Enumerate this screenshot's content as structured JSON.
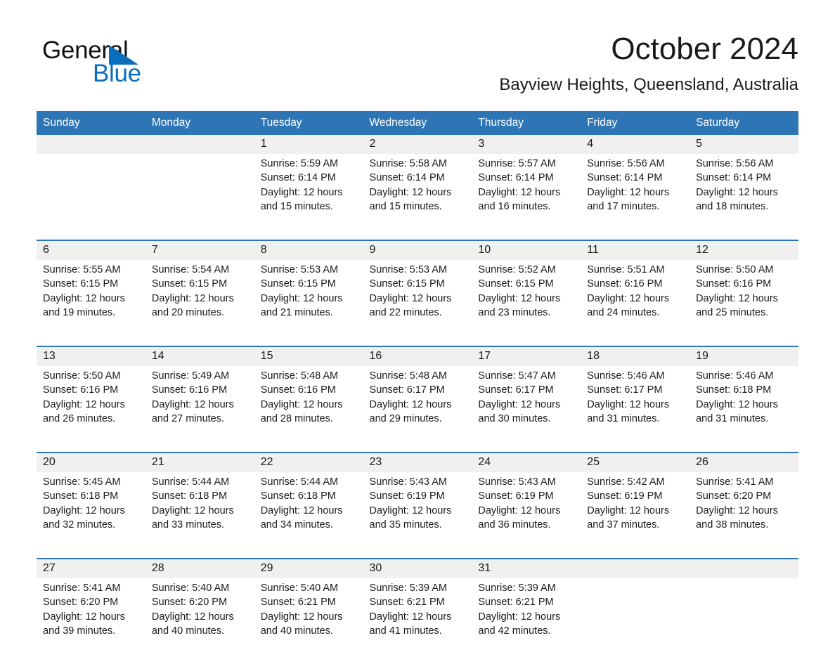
{
  "brand": {
    "name_part1": "General",
    "name_part2": "Blue",
    "triangle_color": "#0a6ebd",
    "blue_color": "#0a6ebd"
  },
  "header": {
    "month_title": "October 2024",
    "location": "Bayview Heights, Queensland, Australia"
  },
  "theme": {
    "header_blue": "#2e75b6",
    "daynum_bg": "#f0f0f0",
    "cell_bg": "#ffffff",
    "text_color": "#1a1a1a"
  },
  "weekday_headers": [
    "Sunday",
    "Monday",
    "Tuesday",
    "Wednesday",
    "Thursday",
    "Friday",
    "Saturday"
  ],
  "weeks": [
    [
      {
        "day": "",
        "sunrise": "",
        "sunset": "",
        "daylight": "",
        "daylight2": ""
      },
      {
        "day": "",
        "sunrise": "",
        "sunset": "",
        "daylight": "",
        "daylight2": ""
      },
      {
        "day": "1",
        "sunrise": "Sunrise: 5:59 AM",
        "sunset": "Sunset: 6:14 PM",
        "daylight": "Daylight: 12 hours",
        "daylight2": "and 15 minutes."
      },
      {
        "day": "2",
        "sunrise": "Sunrise: 5:58 AM",
        "sunset": "Sunset: 6:14 PM",
        "daylight": "Daylight: 12 hours",
        "daylight2": "and 15 minutes."
      },
      {
        "day": "3",
        "sunrise": "Sunrise: 5:57 AM",
        "sunset": "Sunset: 6:14 PM",
        "daylight": "Daylight: 12 hours",
        "daylight2": "and 16 minutes."
      },
      {
        "day": "4",
        "sunrise": "Sunrise: 5:56 AM",
        "sunset": "Sunset: 6:14 PM",
        "daylight": "Daylight: 12 hours",
        "daylight2": "and 17 minutes."
      },
      {
        "day": "5",
        "sunrise": "Sunrise: 5:56 AM",
        "sunset": "Sunset: 6:14 PM",
        "daylight": "Daylight: 12 hours",
        "daylight2": "and 18 minutes."
      }
    ],
    [
      {
        "day": "6",
        "sunrise": "Sunrise: 5:55 AM",
        "sunset": "Sunset: 6:15 PM",
        "daylight": "Daylight: 12 hours",
        "daylight2": "and 19 minutes."
      },
      {
        "day": "7",
        "sunrise": "Sunrise: 5:54 AM",
        "sunset": "Sunset: 6:15 PM",
        "daylight": "Daylight: 12 hours",
        "daylight2": "and 20 minutes."
      },
      {
        "day": "8",
        "sunrise": "Sunrise: 5:53 AM",
        "sunset": "Sunset: 6:15 PM",
        "daylight": "Daylight: 12 hours",
        "daylight2": "and 21 minutes."
      },
      {
        "day": "9",
        "sunrise": "Sunrise: 5:53 AM",
        "sunset": "Sunset: 6:15 PM",
        "daylight": "Daylight: 12 hours",
        "daylight2": "and 22 minutes."
      },
      {
        "day": "10",
        "sunrise": "Sunrise: 5:52 AM",
        "sunset": "Sunset: 6:15 PM",
        "daylight": "Daylight: 12 hours",
        "daylight2": "and 23 minutes."
      },
      {
        "day": "11",
        "sunrise": "Sunrise: 5:51 AM",
        "sunset": "Sunset: 6:16 PM",
        "daylight": "Daylight: 12 hours",
        "daylight2": "and 24 minutes."
      },
      {
        "day": "12",
        "sunrise": "Sunrise: 5:50 AM",
        "sunset": "Sunset: 6:16 PM",
        "daylight": "Daylight: 12 hours",
        "daylight2": "and 25 minutes."
      }
    ],
    [
      {
        "day": "13",
        "sunrise": "Sunrise: 5:50 AM",
        "sunset": "Sunset: 6:16 PM",
        "daylight": "Daylight: 12 hours",
        "daylight2": "and 26 minutes."
      },
      {
        "day": "14",
        "sunrise": "Sunrise: 5:49 AM",
        "sunset": "Sunset: 6:16 PM",
        "daylight": "Daylight: 12 hours",
        "daylight2": "and 27 minutes."
      },
      {
        "day": "15",
        "sunrise": "Sunrise: 5:48 AM",
        "sunset": "Sunset: 6:16 PM",
        "daylight": "Daylight: 12 hours",
        "daylight2": "and 28 minutes."
      },
      {
        "day": "16",
        "sunrise": "Sunrise: 5:48 AM",
        "sunset": "Sunset: 6:17 PM",
        "daylight": "Daylight: 12 hours",
        "daylight2": "and 29 minutes."
      },
      {
        "day": "17",
        "sunrise": "Sunrise: 5:47 AM",
        "sunset": "Sunset: 6:17 PM",
        "daylight": "Daylight: 12 hours",
        "daylight2": "and 30 minutes."
      },
      {
        "day": "18",
        "sunrise": "Sunrise: 5:46 AM",
        "sunset": "Sunset: 6:17 PM",
        "daylight": "Daylight: 12 hours",
        "daylight2": "and 31 minutes."
      },
      {
        "day": "19",
        "sunrise": "Sunrise: 5:46 AM",
        "sunset": "Sunset: 6:18 PM",
        "daylight": "Daylight: 12 hours",
        "daylight2": "and 31 minutes."
      }
    ],
    [
      {
        "day": "20",
        "sunrise": "Sunrise: 5:45 AM",
        "sunset": "Sunset: 6:18 PM",
        "daylight": "Daylight: 12 hours",
        "daylight2": "and 32 minutes."
      },
      {
        "day": "21",
        "sunrise": "Sunrise: 5:44 AM",
        "sunset": "Sunset: 6:18 PM",
        "daylight": "Daylight: 12 hours",
        "daylight2": "and 33 minutes."
      },
      {
        "day": "22",
        "sunrise": "Sunrise: 5:44 AM",
        "sunset": "Sunset: 6:18 PM",
        "daylight": "Daylight: 12 hours",
        "daylight2": "and 34 minutes."
      },
      {
        "day": "23",
        "sunrise": "Sunrise: 5:43 AM",
        "sunset": "Sunset: 6:19 PM",
        "daylight": "Daylight: 12 hours",
        "daylight2": "and 35 minutes."
      },
      {
        "day": "24",
        "sunrise": "Sunrise: 5:43 AM",
        "sunset": "Sunset: 6:19 PM",
        "daylight": "Daylight: 12 hours",
        "daylight2": "and 36 minutes."
      },
      {
        "day": "25",
        "sunrise": "Sunrise: 5:42 AM",
        "sunset": "Sunset: 6:19 PM",
        "daylight": "Daylight: 12 hours",
        "daylight2": "and 37 minutes."
      },
      {
        "day": "26",
        "sunrise": "Sunrise: 5:41 AM",
        "sunset": "Sunset: 6:20 PM",
        "daylight": "Daylight: 12 hours",
        "daylight2": "and 38 minutes."
      }
    ],
    [
      {
        "day": "27",
        "sunrise": "Sunrise: 5:41 AM",
        "sunset": "Sunset: 6:20 PM",
        "daylight": "Daylight: 12 hours",
        "daylight2": "and 39 minutes."
      },
      {
        "day": "28",
        "sunrise": "Sunrise: 5:40 AM",
        "sunset": "Sunset: 6:20 PM",
        "daylight": "Daylight: 12 hours",
        "daylight2": "and 40 minutes."
      },
      {
        "day": "29",
        "sunrise": "Sunrise: 5:40 AM",
        "sunset": "Sunset: 6:21 PM",
        "daylight": "Daylight: 12 hours",
        "daylight2": "and 40 minutes."
      },
      {
        "day": "30",
        "sunrise": "Sunrise: 5:39 AM",
        "sunset": "Sunset: 6:21 PM",
        "daylight": "Daylight: 12 hours",
        "daylight2": "and 41 minutes."
      },
      {
        "day": "31",
        "sunrise": "Sunrise: 5:39 AM",
        "sunset": "Sunset: 6:21 PM",
        "daylight": "Daylight: 12 hours",
        "daylight2": "and 42 minutes."
      },
      {
        "day": "",
        "sunrise": "",
        "sunset": "",
        "daylight": "",
        "daylight2": ""
      },
      {
        "day": "",
        "sunrise": "",
        "sunset": "",
        "daylight": "",
        "daylight2": ""
      }
    ]
  ]
}
